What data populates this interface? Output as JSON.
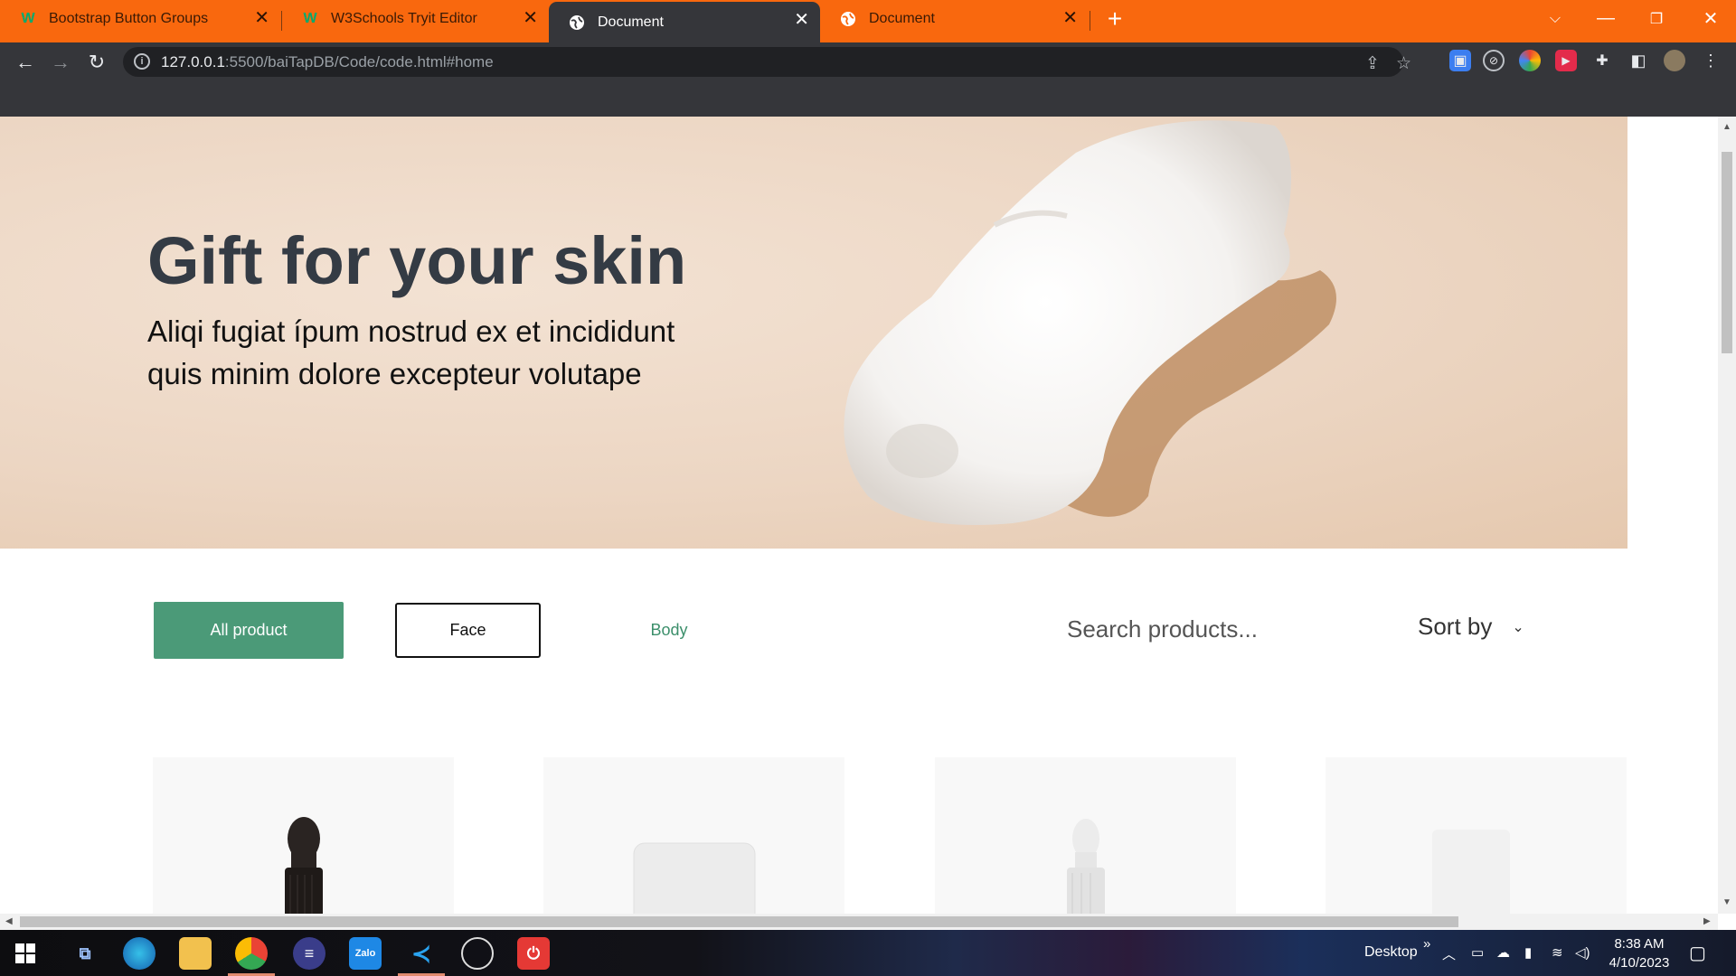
{
  "browser": {
    "tabs": [
      {
        "title": "Bootstrap Button Groups",
        "favicon": "w3schools-icon",
        "active": false
      },
      {
        "title": "W3Schools Tryit Editor",
        "favicon": "w3schools-icon",
        "active": false
      },
      {
        "title": "Document",
        "favicon": "globe-icon",
        "active": true
      },
      {
        "title": "Document",
        "favicon": "globe-icon",
        "active": false
      }
    ],
    "url_host": "127.0.0.1",
    "url_rest": ":5500/baiTapDB/Code/code.html#home",
    "tab_bar_color": "#f9680e"
  },
  "hero": {
    "title": "Gift for your skin",
    "subtitle": "Aliqi fugiat ípum nostrud ex et incididunt quis minim dolore excepteur volutape"
  },
  "filters": {
    "all_label": "All product",
    "face_label": "Face",
    "body_label": "Body",
    "accent": "#4b9a78"
  },
  "search": {
    "placeholder": "Search products..."
  },
  "sort": {
    "label": "Sort by"
  },
  "products": [
    {
      "name": "dropper-bottle-dark"
    },
    {
      "name": "cream-jar-white"
    },
    {
      "name": "dropper-bottle-white"
    },
    {
      "name": "bottle-white"
    }
  ],
  "taskbar": {
    "desktop_label": "Desktop",
    "time": "8:38 AM",
    "date": "4/10/2023"
  }
}
